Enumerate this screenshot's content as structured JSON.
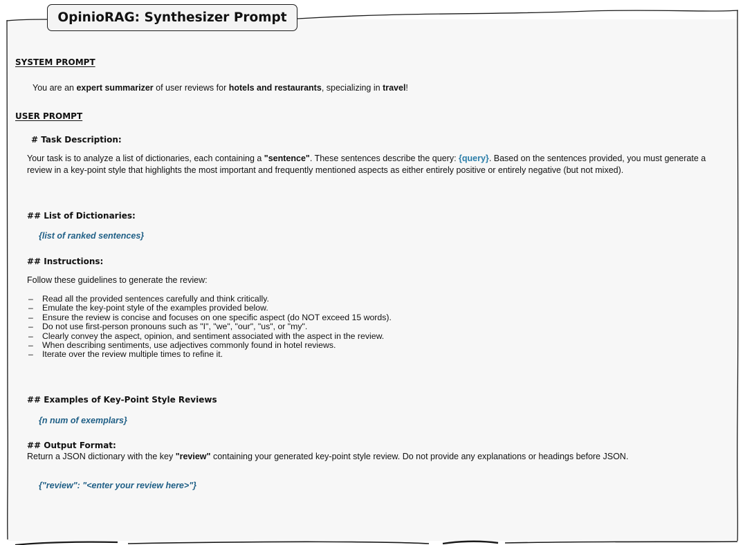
{
  "title": "OpinioRAG: Synthesizer Prompt",
  "system": {
    "heading": "SYSTEM PROMPT",
    "parts": [
      "You are an ",
      "expert summarizer",
      " of user reviews for ",
      "hotels and restaurants",
      ", specializing in ",
      "travel",
      "!"
    ]
  },
  "user": {
    "heading": "USER PROMPT",
    "task": {
      "heading": "# Task Description:",
      "parts": [
        "Your task is to analyze a list of dictionaries, each containing a ",
        "\"sentence\"",
        ". These sentences describe the query: ",
        "{query}",
        ". Based on the sentences provided, you must generate a review in a key-point style that highlights the most important and frequently mentioned aspects as either entirely positive or entirely negative (but not mixed)."
      ]
    },
    "dicts": {
      "heading": "## List of Dictionaries:",
      "placeholder": "{list of ranked sentences}"
    },
    "instructions": {
      "heading": "## Instructions:",
      "intro": "Follow these guidelines to generate the review:",
      "dash": "–",
      "items": [
        "Read all the provided sentences carefully and think critically.",
        "Emulate the key-point style of the examples provided below.",
        "Ensure the review is concise and focuses on one specific aspect (do NOT exceed 15 words).",
        "Do not use first-person pronouns such as \"I\", \"we\", \"our\", \"us\", or \"my\".",
        "Clearly convey the aspect, opinion, and sentiment associated with the aspect in the review.",
        "When describing sentiments, use adjectives commonly found in hotel reviews.",
        "Iterate over the review multiple times to refine it."
      ]
    },
    "examples": {
      "heading": "## Examples of Key-Point Style Reviews",
      "placeholder": "{n num of exemplars}"
    },
    "output": {
      "heading": "## Output Format:",
      "parts": [
        " Return a JSON dictionary with the key ",
        "\"review\"",
        " containing your generated key-point style review. Do not provide any explanations or headings before JSON."
      ],
      "placeholder": "{\"review\": \"<enter your review here>\"}"
    }
  },
  "colors": {
    "placeholder": "#1f5f86",
    "query": "#2a7da8",
    "panel": "#f7f7f7",
    "stroke": "#1a1a1a"
  }
}
